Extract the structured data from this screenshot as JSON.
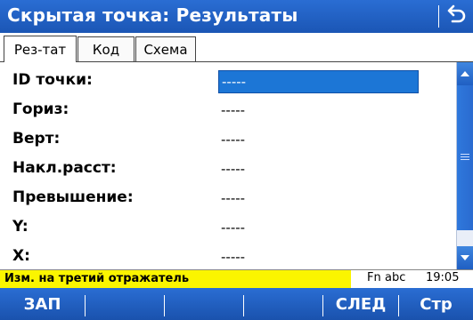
{
  "window": {
    "title": "Скрытая точка: Результаты",
    "back_icon": "return-arrow-icon"
  },
  "tabs": [
    {
      "label": "Рез-тат",
      "active": true
    },
    {
      "label": "Код",
      "active": false
    },
    {
      "label": "Схема",
      "active": false
    }
  ],
  "fields": [
    {
      "label": "ID точки:",
      "value": "-----",
      "selected": true
    },
    {
      "label": "Гориз:",
      "value": "-----"
    },
    {
      "label": "Верт:",
      "value": "-----"
    },
    {
      "label": "Накл.расст:",
      "value": "-----"
    },
    {
      "label": "Превышение:",
      "value": "-----"
    },
    {
      "label": "Y:",
      "value": "-----"
    },
    {
      "label": "X:",
      "value": "-----"
    }
  ],
  "status": {
    "message": "Изм. на третий отражатель",
    "message_color": "#fbf500",
    "fn": "Fn",
    "input_mode": "abc",
    "time": "19:05"
  },
  "softkeys": [
    {
      "label": "ЗАП"
    },
    {
      "label": ""
    },
    {
      "label": ""
    },
    {
      "label": ""
    },
    {
      "label": "СЛЕД"
    },
    {
      "label": "Стр"
    }
  ],
  "colors": {
    "accent": "#1c76d6",
    "header": "#1f5fc2"
  }
}
